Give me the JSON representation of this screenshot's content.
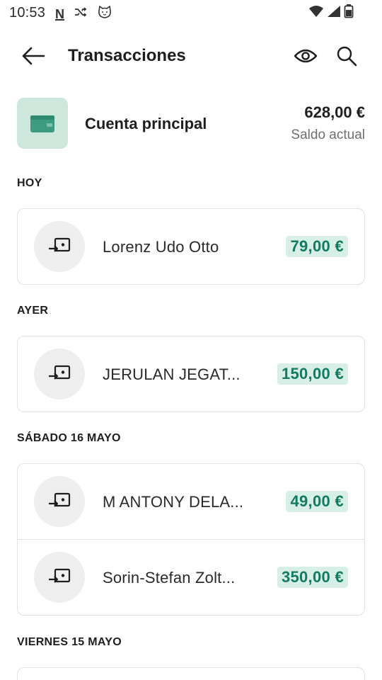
{
  "status_bar": {
    "time": "10:53",
    "notification_icons": [
      "n-news-icon",
      "shuffle-icon",
      "cat-face-icon"
    ],
    "system_icons": [
      "wifi-icon",
      "cell-signal-icon",
      "battery-icon"
    ]
  },
  "header": {
    "title": "Transacciones",
    "back_icon": "arrow-left-icon",
    "actions": [
      "eye-icon",
      "search-icon"
    ]
  },
  "account": {
    "name": "Cuenta principal",
    "balance": "628,00 €",
    "balance_label": "Saldo actual",
    "tile_color": "#cce7dc",
    "wallet_color": "#3d9b7f"
  },
  "sections": [
    {
      "label": "HOY",
      "transactions": [
        {
          "name": "Lorenz Udo Otto",
          "amount": "79,00 €",
          "icon": "transfer-in-icon"
        }
      ]
    },
    {
      "label": "AYER",
      "transactions": [
        {
          "name": "JERULAN JEGAT...",
          "amount": "150,00 €",
          "icon": "transfer-in-icon"
        }
      ]
    },
    {
      "label": "SÁBADO 16 MAYO",
      "transactions": [
        {
          "name": "M ANTONY DELA...",
          "amount": "49,00 €",
          "icon": "transfer-in-icon"
        },
        {
          "name": "Sorin-Stefan Zolt...",
          "amount": "350,00 €",
          "icon": "transfer-in-icon"
        }
      ]
    },
    {
      "label": "VIERNES 15 MAYO",
      "transactions": []
    }
  ],
  "colors": {
    "accent_text": "#137a62",
    "amount_chip": "#d7efe6",
    "card_border": "#e2e2e2",
    "icon_circle": "#eeeeee"
  }
}
